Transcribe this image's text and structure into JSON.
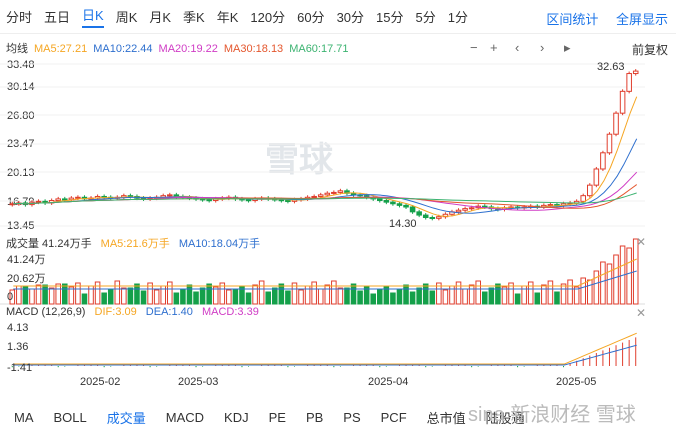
{
  "tabs": [
    "分时",
    "五日",
    "日K",
    "周K",
    "月K",
    "季K",
    "年K",
    "120分",
    "60分",
    "30分",
    "15分",
    "5分",
    "1分"
  ],
  "tabs_right": [
    "区间统计",
    "全屏显示"
  ],
  "ma_labels": [
    {
      "text": "均线",
      "color": "#333333"
    },
    {
      "text": "MA5:27.21",
      "color": "#f5a623"
    },
    {
      "text": "MA10:22.44",
      "color": "#2e6fce"
    },
    {
      "text": "MA20:19.22",
      "color": "#d03cc5"
    },
    {
      "text": "MA30:18.13",
      "color": "#e4572e"
    },
    {
      "text": "MA60:17.71",
      "color": "#3cb371"
    }
  ],
  "controls": {
    "minus": "−",
    "plus": "+",
    "left": "‹",
    "right": "›",
    "price_mode": "前复权"
  },
  "price_axis": [
    "33.48",
    "30.14",
    "26.80",
    "23.47",
    "20.13",
    "16.79",
    "13.45"
  ],
  "high_label": "32.63",
  "low_label": "14.30",
  "volume": {
    "title": "成交量 41.24万手",
    "ma5": "MA5:21.6万手",
    "ma10": "MA10:18.04万手",
    "axis": [
      "41.24万",
      "20.62万",
      "0"
    ]
  },
  "macd": {
    "title": "MACD (12,26,9)",
    "dif": "DIF:3.09",
    "dea": "DEA:1.40",
    "macd": "MACD:3.39",
    "axis": [
      "4.13",
      "1.36",
      "-1.41"
    ]
  },
  "x_labels": [
    "2025-02",
    "2025-03",
    "2025-04",
    "2025-05"
  ],
  "bottom_tabs": [
    "MA",
    "BOLL",
    "成交量",
    "MACD",
    "KDJ",
    "PE",
    "PB",
    "PS",
    "PCF",
    "总市值",
    "陆股通"
  ],
  "watermark": "雪球",
  "watermark2": "sina 新浪财经 雪球",
  "colors": {
    "up": "#e03e2d",
    "down": "#14a04a",
    "accent": "#1a73e8"
  },
  "chart_data": {
    "type": "candlestick",
    "price_range": [
      13.45,
      33.48
    ],
    "high": 32.63,
    "low": 14.3,
    "closes": [
      16.2,
      16.3,
      16.1,
      16.4,
      16.5,
      16.3,
      16.6,
      16.8,
      16.7,
      16.9,
      17.0,
      16.8,
      16.9,
      17.1,
      17.0,
      16.9,
      17.0,
      17.2,
      17.1,
      16.9,
      16.8,
      16.9,
      17.0,
      17.2,
      17.3,
      17.1,
      17.0,
      16.9,
      16.8,
      16.7,
      16.6,
      16.8,
      16.9,
      17.0,
      16.8,
      16.7,
      16.6,
      16.8,
      16.9,
      16.8,
      16.7,
      16.6,
      16.5,
      16.7,
      16.8,
      17.0,
      17.1,
      17.3,
      17.5,
      17.6,
      17.8,
      17.5,
      17.3,
      17.2,
      17.0,
      16.8,
      16.6,
      16.4,
      16.2,
      16.0,
      15.8,
      15.2,
      14.8,
      14.5,
      14.4,
      14.6,
      14.9,
      15.2,
      15.4,
      15.6,
      15.7,
      15.9,
      15.8,
      15.6,
      15.5,
      15.7,
      15.8,
      15.7,
      15.8,
      15.9,
      15.8,
      16.0,
      16.1,
      16.0,
      16.2,
      16.3,
      16.5,
      17.2,
      18.5,
      20.5,
      22.5,
      24.8,
      27.4,
      30.1,
      32.3,
      32.6
    ]
  }
}
